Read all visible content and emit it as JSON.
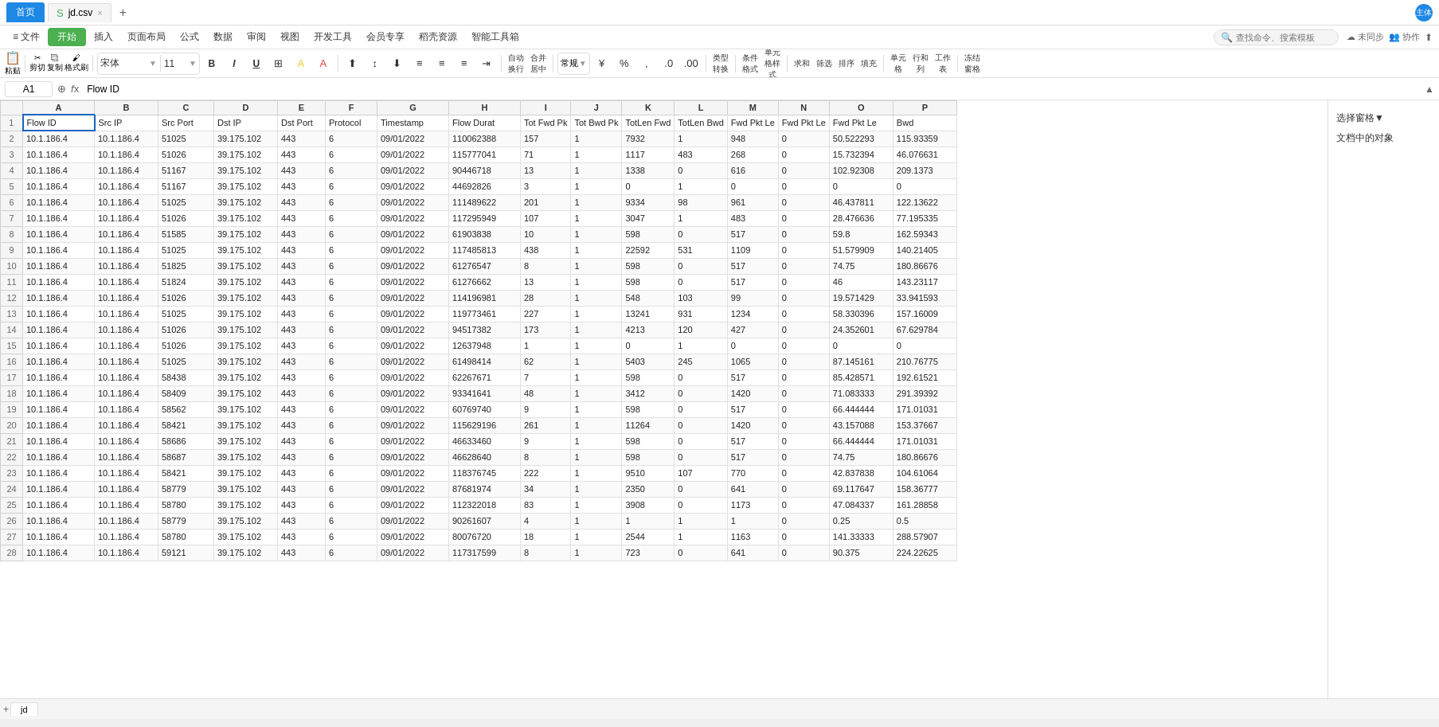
{
  "titleBar": {
    "homeTab": "首页",
    "fileTab": "jd.csv",
    "fileIcon": "S",
    "addTab": "+",
    "avatar": "主体",
    "closeBtn": "×"
  },
  "menuBar": {
    "items": [
      "≡ 文件",
      "插入",
      "页面布局",
      "公式",
      "数据",
      "审阅",
      "视图",
      "开发工具",
      "会员专享",
      "稻壳资源",
      "智能工具箱"
    ],
    "startBtn": "开始",
    "searchPlaceholder": "查找命令、搜索模板",
    "syncBtn": "未同步",
    "collabBtn": "协作"
  },
  "toolbar": {
    "pasteLabel": "粘贴",
    "cutLabel": "剪切",
    "copyLabel": "复制",
    "formatLabel": "格式刷",
    "fontName": "宋体",
    "fontSize": "11",
    "boldLabel": "B",
    "italicLabel": "I",
    "underlineLabel": "U",
    "borderLabel": "⊞",
    "fillLabel": "A",
    "fontColorLabel": "A",
    "alignLeft": "≡",
    "alignCenter": "≡",
    "alignRight": "≡",
    "wrapLabel": "自动换行",
    "mergeLabel": "合并居中",
    "formatNumber": "常规",
    "percentLabel": "%",
    "commaLabel": ",",
    "increaseDecLabel": ".0",
    "decreaseDecLabel": ".00",
    "typeConvertLabel": "类型转换",
    "conditionalLabel": "条件格式",
    "cellStyleLabel": "单元格样式",
    "sumLabel": "求和",
    "filterLabel": "筛选",
    "sortLabel": "排序",
    "fillDownLabel": "填充",
    "insertCellLabel": "单元格",
    "rowColLabel": "行和列",
    "tableLabel": "工作表",
    "freezeLabel": "冻结窗格"
  },
  "formulaBar": {
    "cellRef": "A1",
    "formulaText": "Flow ID"
  },
  "rightPanel": {
    "items": [
      "选择窗格▼",
      "文档中的对象"
    ]
  },
  "columns": [
    "A",
    "B",
    "C",
    "D",
    "E",
    "F",
    "G",
    "H",
    "I",
    "J",
    "K",
    "L",
    "M",
    "N",
    "O",
    "P"
  ],
  "headers": [
    "Flow  ID",
    "Src IP",
    "Src Port",
    "Dst IP",
    "Dst Port",
    "Protocol",
    "Timestamp",
    "Flow Durat",
    "Tot Fwd Pk",
    "Tot Bwd Pk",
    "TotLen Fwd",
    "TotLen Bwd",
    "Fwd Pkt Le",
    "Fwd Pkt Le",
    "Fwd Pkt Le",
    "Bwd"
  ],
  "rows": [
    [
      "10.1.186.4",
      "10.1.186.4",
      "51025",
      "39.175.102",
      "443",
      "6",
      "09/01/2022",
      "110062388",
      "157",
      "1",
      "7932",
      "1",
      "948",
      "0",
      "50.522293",
      "115.93359"
    ],
    [
      "10.1.186.4",
      "10.1.186.4",
      "51026",
      "39.175.102",
      "443",
      "6",
      "09/01/2022",
      "115777041",
      "71",
      "1",
      "1117",
      "483",
      "268",
      "0",
      "15.732394",
      "46.076631"
    ],
    [
      "10.1.186.4",
      "10.1.186.4",
      "51167",
      "39.175.102",
      "443",
      "6",
      "09/01/2022",
      "90446718",
      "13",
      "1",
      "1338",
      "0",
      "616",
      "0",
      "102.92308",
      "209.1373"
    ],
    [
      "10.1.186.4",
      "10.1.186.4",
      "51167",
      "39.175.102",
      "443",
      "6",
      "09/01/2022",
      "44692826",
      "3",
      "1",
      "0",
      "1",
      "0",
      "0",
      "0",
      "0"
    ],
    [
      "10.1.186.4",
      "10.1.186.4",
      "51025",
      "39.175.102",
      "443",
      "6",
      "09/01/2022",
      "111489622",
      "201",
      "1",
      "9334",
      "98",
      "961",
      "0",
      "46.437811",
      "122.13622"
    ],
    [
      "10.1.186.4",
      "10.1.186.4",
      "51026",
      "39.175.102",
      "443",
      "6",
      "09/01/2022",
      "117295949",
      "107",
      "1",
      "3047",
      "1",
      "483",
      "0",
      "28.476636",
      "77.195335"
    ],
    [
      "10.1.186.4",
      "10.1.186.4",
      "51585",
      "39.175.102",
      "443",
      "6",
      "09/01/2022",
      "61903838",
      "10",
      "1",
      "598",
      "0",
      "517",
      "0",
      "59.8",
      "162.59343"
    ],
    [
      "10.1.186.4",
      "10.1.186.4",
      "51025",
      "39.175.102",
      "443",
      "6",
      "09/01/2022",
      "117485813",
      "438",
      "1",
      "22592",
      "531",
      "1109",
      "0",
      "51.579909",
      "140.21405"
    ],
    [
      "10.1.186.4",
      "10.1.186.4",
      "51825",
      "39.175.102",
      "443",
      "6",
      "09/01/2022",
      "61276547",
      "8",
      "1",
      "598",
      "0",
      "517",
      "0",
      "74.75",
      "180.86676"
    ],
    [
      "10.1.186.4",
      "10.1.186.4",
      "51824",
      "39.175.102",
      "443",
      "6",
      "09/01/2022",
      "61276662",
      "13",
      "1",
      "598",
      "0",
      "517",
      "0",
      "46",
      "143.23117"
    ],
    [
      "10.1.186.4",
      "10.1.186.4",
      "51026",
      "39.175.102",
      "443",
      "6",
      "09/01/2022",
      "114196981",
      "28",
      "1",
      "548",
      "103",
      "99",
      "0",
      "19.571429",
      "33.941593"
    ],
    [
      "10.1.186.4",
      "10.1.186.4",
      "51025",
      "39.175.102",
      "443",
      "6",
      "09/01/2022",
      "119773461",
      "227",
      "1",
      "13241",
      "931",
      "1234",
      "0",
      "58.330396",
      "157.16009"
    ],
    [
      "10.1.186.4",
      "10.1.186.4",
      "51026",
      "39.175.102",
      "443",
      "6",
      "09/01/2022",
      "94517382",
      "173",
      "1",
      "4213",
      "120",
      "427",
      "0",
      "24.352601",
      "67.629784"
    ],
    [
      "10.1.186.4",
      "10.1.186.4",
      "51026",
      "39.175.102",
      "443",
      "6",
      "09/01/2022",
      "12637948",
      "1",
      "1",
      "0",
      "1",
      "0",
      "0",
      "0",
      "0"
    ],
    [
      "10.1.186.4",
      "10.1.186.4",
      "51025",
      "39.175.102",
      "443",
      "6",
      "09/01/2022",
      "61498414",
      "62",
      "1",
      "5403",
      "245",
      "1065",
      "0",
      "87.145161",
      "210.76775"
    ],
    [
      "10.1.186.4",
      "10.1.186.4",
      "58438",
      "39.175.102",
      "443",
      "6",
      "09/01/2022",
      "62267671",
      "7",
      "1",
      "598",
      "0",
      "517",
      "0",
      "85.428571",
      "192.61521"
    ],
    [
      "10.1.186.4",
      "10.1.186.4",
      "58409",
      "39.175.102",
      "443",
      "6",
      "09/01/2022",
      "93341641",
      "48",
      "1",
      "3412",
      "0",
      "1420",
      "0",
      "71.083333",
      "291.39392"
    ],
    [
      "10.1.186.4",
      "10.1.186.4",
      "58562",
      "39.175.102",
      "443",
      "6",
      "09/01/2022",
      "60769740",
      "9",
      "1",
      "598",
      "0",
      "517",
      "0",
      "66.444444",
      "171.01031"
    ],
    [
      "10.1.186.4",
      "10.1.186.4",
      "58421",
      "39.175.102",
      "443",
      "6",
      "09/01/2022",
      "115629196",
      "261",
      "1",
      "11264",
      "0",
      "1420",
      "0",
      "43.157088",
      "153.37667"
    ],
    [
      "10.1.186.4",
      "10.1.186.4",
      "58686",
      "39.175.102",
      "443",
      "6",
      "09/01/2022",
      "46633460",
      "9",
      "1",
      "598",
      "0",
      "517",
      "0",
      "66.444444",
      "171.01031"
    ],
    [
      "10.1.186.4",
      "10.1.186.4",
      "58687",
      "39.175.102",
      "443",
      "6",
      "09/01/2022",
      "46628640",
      "8",
      "1",
      "598",
      "0",
      "517",
      "0",
      "74.75",
      "180.86676"
    ],
    [
      "10.1.186.4",
      "10.1.186.4",
      "58421",
      "39.175.102",
      "443",
      "6",
      "09/01/2022",
      "118376745",
      "222",
      "1",
      "9510",
      "107",
      "770",
      "0",
      "42.837838",
      "104.61064"
    ],
    [
      "10.1.186.4",
      "10.1.186.4",
      "58779",
      "39.175.102",
      "443",
      "6",
      "09/01/2022",
      "87681974",
      "34",
      "1",
      "2350",
      "0",
      "641",
      "0",
      "69.117647",
      "158.36777"
    ],
    [
      "10.1.186.4",
      "10.1.186.4",
      "58780",
      "39.175.102",
      "443",
      "6",
      "09/01/2022",
      "112322018",
      "83",
      "1",
      "3908",
      "0",
      "1173",
      "0",
      "47.084337",
      "161.28858"
    ],
    [
      "10.1.186.4",
      "10.1.186.4",
      "58779",
      "39.175.102",
      "443",
      "6",
      "09/01/2022",
      "90261607",
      "4",
      "1",
      "1",
      "1",
      "1",
      "0",
      "0.25",
      "0.5"
    ],
    [
      "10.1.186.4",
      "10.1.186.4",
      "58780",
      "39.175.102",
      "443",
      "6",
      "09/01/2022",
      "80076720",
      "18",
      "1",
      "2544",
      "1",
      "1163",
      "0",
      "141.33333",
      "288.57907"
    ],
    [
      "10.1.186.4",
      "10.1.186.4",
      "59121",
      "39.175.102",
      "443",
      "6",
      "09/01/2022",
      "117317599",
      "8",
      "1",
      "723",
      "0",
      "641",
      "0",
      "90.375",
      "224.22625"
    ]
  ],
  "sheetTab": "jd"
}
